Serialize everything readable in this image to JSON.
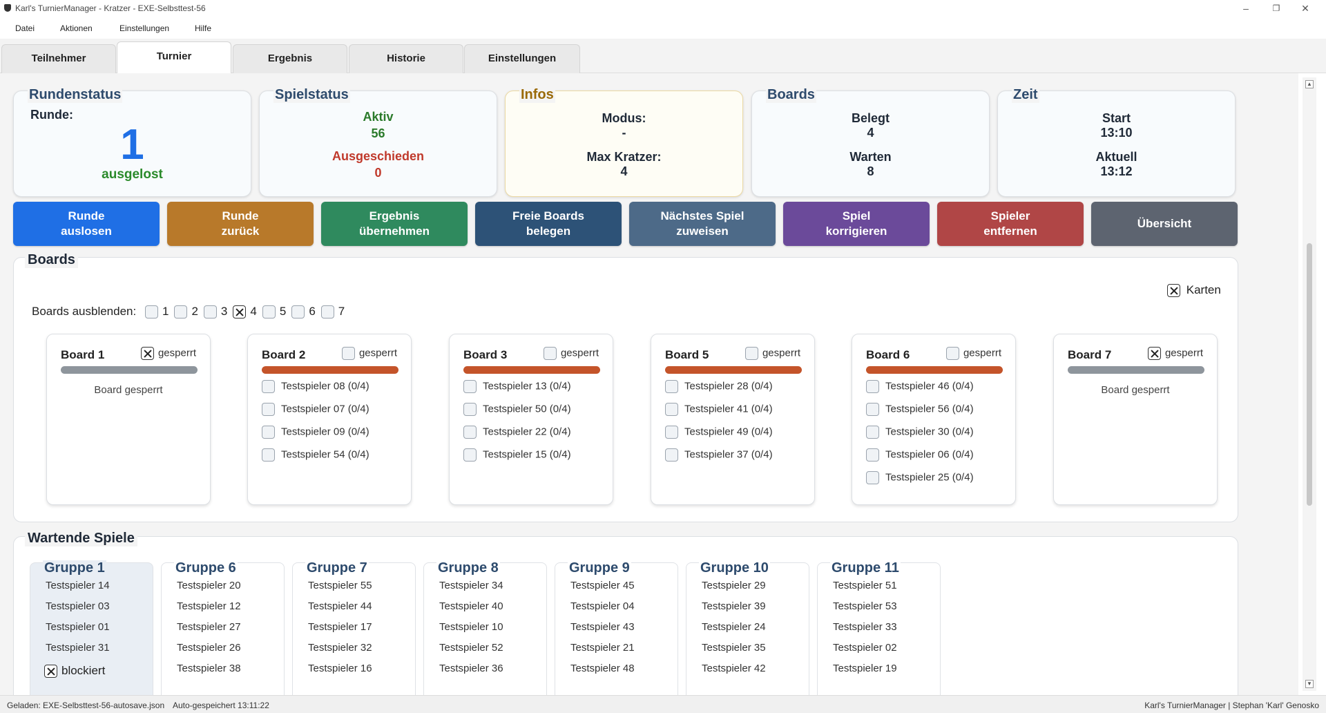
{
  "window": {
    "title": "Karl's TurnierManager - Kratzer - EXE-Selbsttest-56"
  },
  "menu": [
    "Datei",
    "Aktionen",
    "Einstellungen",
    "Hilfe"
  ],
  "tabs": [
    "Teilnehmer",
    "Turnier",
    "Ergebnis",
    "Historie",
    "Einstellungen"
  ],
  "active_tab": "Turnier",
  "status_cards": {
    "rundenstatus": {
      "title": "Rundenstatus",
      "label": "Runde:",
      "round": "1",
      "state": "ausgelost"
    },
    "spielstatus": {
      "title": "Spielstatus",
      "active_label": "Aktiv",
      "active_value": "56",
      "out_label": "Ausgeschieden",
      "out_value": "0"
    },
    "infos": {
      "title": "Infos",
      "mode_label": "Modus:",
      "mode_value": "-",
      "max_label": "Max Kratzer:",
      "max_value": "4"
    },
    "boards": {
      "title": "Boards",
      "used_label": "Belegt",
      "used_value": "4",
      "wait_label": "Warten",
      "wait_value": "8"
    },
    "zeit": {
      "title": "Zeit",
      "start_label": "Start",
      "start_value": "13:10",
      "now_label": "Aktuell",
      "now_value": "13:12"
    }
  },
  "actions": [
    {
      "label": "Runde\nauslosen",
      "color": "#1f6fe5"
    },
    {
      "label": "Runde\nzurück",
      "color": "#b8792a"
    },
    {
      "label": "Ergebnis\nübernehmen",
      "color": "#2f8a5e"
    },
    {
      "label": "Freie Boards\nbelegen",
      "color": "#2d5277"
    },
    {
      "label": "Nächstes Spiel\nzuweisen",
      "color": "#4d6a88"
    },
    {
      "label": "Spiel\nkorrigieren",
      "color": "#6b4a9a"
    },
    {
      "label": "Spieler\nentfernen",
      "color": "#b04646"
    },
    {
      "label": "Übersicht",
      "color": "#5d6470"
    }
  ],
  "boards_panel": {
    "title": "Boards",
    "hide_label": "Boards ausblenden:",
    "hide_options": [
      {
        "n": "1",
        "checked": false
      },
      {
        "n": "2",
        "checked": false
      },
      {
        "n": "3",
        "checked": false
      },
      {
        "n": "4",
        "checked": true
      },
      {
        "n": "5",
        "checked": false
      },
      {
        "n": "6",
        "checked": false
      },
      {
        "n": "7",
        "checked": false
      }
    ],
    "cards_label": "Karten",
    "cards_checked": true,
    "lock_label": "gesperrt",
    "locked_text": "Board gesperrt",
    "boards": [
      {
        "name": "Board 1",
        "locked": true,
        "players": []
      },
      {
        "name": "Board 2",
        "locked": false,
        "players": [
          "Testspieler 08 (0/4)",
          "Testspieler 07 (0/4)",
          "Testspieler 09 (0/4)",
          "Testspieler 54 (0/4)"
        ]
      },
      {
        "name": "Board 3",
        "locked": false,
        "players": [
          "Testspieler 13 (0/4)",
          "Testspieler 50 (0/4)",
          "Testspieler 22 (0/4)",
          "Testspieler 15 (0/4)"
        ]
      },
      {
        "name": "Board 5",
        "locked": false,
        "players": [
          "Testspieler 28 (0/4)",
          "Testspieler 41 (0/4)",
          "Testspieler 49 (0/4)",
          "Testspieler 37 (0/4)"
        ]
      },
      {
        "name": "Board 6",
        "locked": false,
        "players": [
          "Testspieler 46 (0/4)",
          "Testspieler 56 (0/4)",
          "Testspieler 30 (0/4)",
          "Testspieler 06 (0/4)",
          "Testspieler 25 (0/4)"
        ]
      },
      {
        "name": "Board 7",
        "locked": true,
        "players": []
      }
    ]
  },
  "waiting_panel": {
    "title": "Wartende Spiele",
    "block_label": "blockiert",
    "groups": [
      {
        "name": "Gruppe 1",
        "players": [
          "Testspieler 14",
          "Testspieler 03",
          "Testspieler 01",
          "Testspieler 31"
        ],
        "blocked": true
      },
      {
        "name": "Gruppe 6",
        "players": [
          "Testspieler 20",
          "Testspieler 12",
          "Testspieler 27",
          "Testspieler 26",
          "Testspieler 38"
        ],
        "blocked": false
      },
      {
        "name": "Gruppe 7",
        "players": [
          "Testspieler 55",
          "Testspieler 44",
          "Testspieler 17",
          "Testspieler 32",
          "Testspieler 16"
        ],
        "blocked": false
      },
      {
        "name": "Gruppe 8",
        "players": [
          "Testspieler 34",
          "Testspieler 40",
          "Testspieler 10",
          "Testspieler 52",
          "Testspieler 36"
        ],
        "blocked": false
      },
      {
        "name": "Gruppe 9",
        "players": [
          "Testspieler 45",
          "Testspieler 04",
          "Testspieler 43",
          "Testspieler 21",
          "Testspieler 48"
        ],
        "blocked": false
      },
      {
        "name": "Gruppe 10",
        "players": [
          "Testspieler 29",
          "Testspieler 39",
          "Testspieler 24",
          "Testspieler 35",
          "Testspieler 42"
        ],
        "blocked": false
      },
      {
        "name": "Gruppe 11",
        "players": [
          "Testspieler 51",
          "Testspieler 53",
          "Testspieler 33",
          "Testspieler 02",
          "Testspieler 19"
        ],
        "blocked": false
      }
    ]
  },
  "statusbar": {
    "loaded": "Geladen: EXE-Selbsttest-56-autosave.json",
    "autosave": "Auto-gespeichert 13:11:22",
    "credit": "Karl's TurnierManager | Stephan 'Karl' Genosko"
  }
}
